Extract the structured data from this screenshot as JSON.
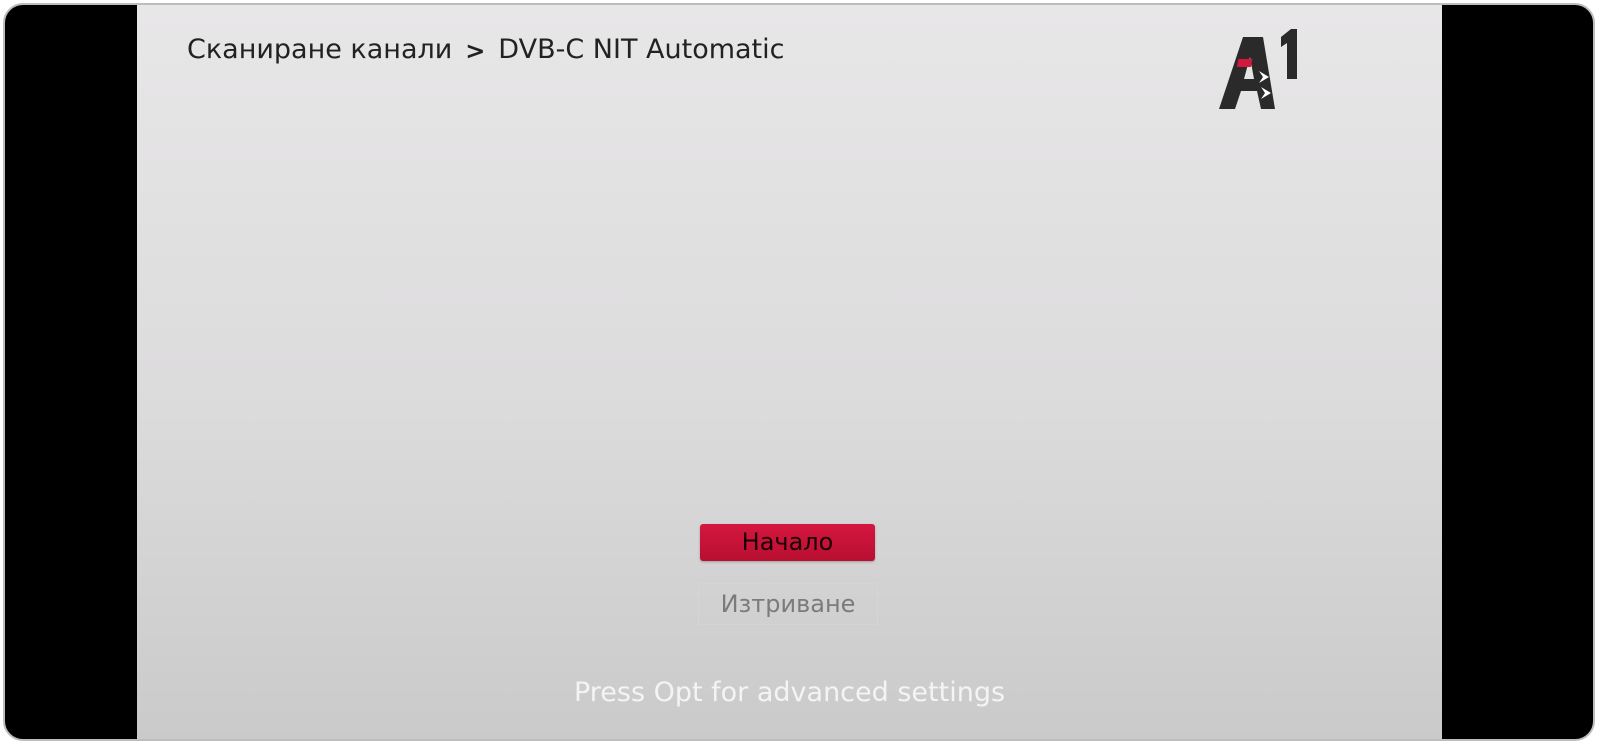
{
  "header": {
    "breadcrumb_parent": "Сканиране канали",
    "breadcrumb_separator": ">",
    "breadcrumb_current": "DVB-C NIT Automatic"
  },
  "logo": {
    "text": "A1",
    "accent_color": "#d4173e"
  },
  "actions": {
    "start_label": "Начало",
    "delete_label": "Изтриване"
  },
  "footer": {
    "hint": "Press Opt for advanced settings"
  },
  "colors": {
    "accent": "#c8123a",
    "background": "#dcdbdc",
    "frame": "#000000"
  }
}
